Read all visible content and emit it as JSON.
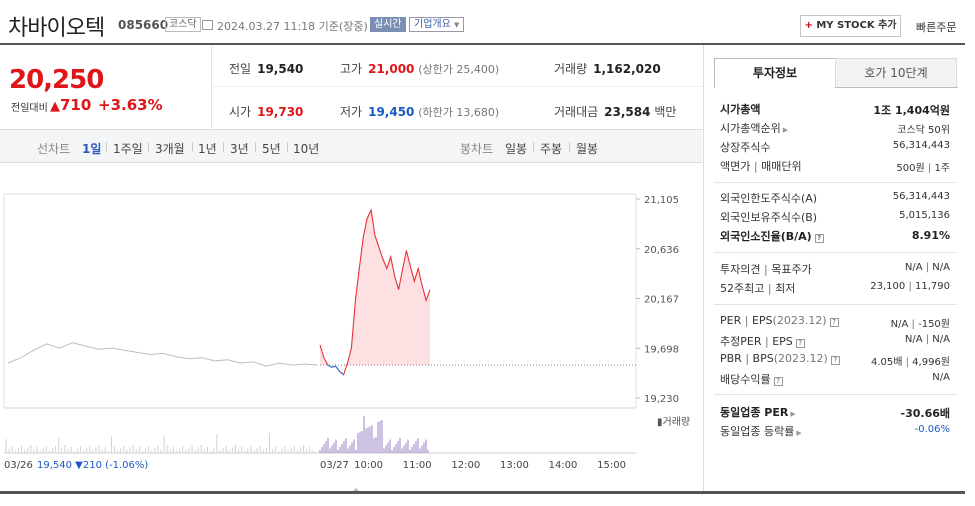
{
  "header": {
    "stock_name": "차바이오텍",
    "code": "085660",
    "market": "코스닥",
    "datetime": "2024.03.27 11:18 기준(장중)",
    "realtime_badge": "실시간",
    "overview_button": "기업개요",
    "mystock_plus": "+",
    "mystock_label": " MY STOCK 추가",
    "quick_order": "빠른주문"
  },
  "price": {
    "current": "20,250",
    "change_label": "전일대비",
    "change_arrow": "▲",
    "change": "710",
    "change_pct": "+3.63%"
  },
  "stats": {
    "prev_close_label": "전일",
    "prev_close": "19,540",
    "high_label": "고가",
    "high": "21,000",
    "upper_limit": "(상한가 25,400)",
    "volume_label": "거래량",
    "volume": "1,162,020",
    "open_label": "시가",
    "open": "19,730",
    "low_label": "저가",
    "low": "19,450",
    "lower_limit": "(하한가 13,680)",
    "amount_label": "거래대금",
    "amount": "23,584",
    "amount_unit": "백만"
  },
  "periods": {
    "line_label": "선차트",
    "items": [
      "1일",
      "1주일",
      "3개월",
      "1년",
      "3년",
      "5년",
      "10년"
    ],
    "selected_index": 0,
    "candle_label": "봉차트",
    "candle_items": [
      "일봉",
      "주봉",
      "월봉"
    ]
  },
  "chart_data": {
    "type": "line",
    "y_ticks": [
      "21,105",
      "20,636",
      "20,167",
      "19,698",
      "19,230"
    ],
    "ylim": [
      19230,
      21105
    ],
    "prev_close_ref": 19540,
    "x_ticks": [
      "03/26",
      "03/27",
      "10:00",
      "11:00",
      "12:00",
      "13:00",
      "14:00",
      "15:00"
    ],
    "prev_day_caption": {
      "date": "03/26",
      "close": "19,540",
      "change": "▼210",
      "pct": "(-1.06%)"
    },
    "volume_legend": "거래량",
    "series": [
      {
        "name": "",
        "values": [
          19560,
          19610,
          19680,
          19740,
          19700,
          19750,
          19720,
          19690,
          19700,
          19680,
          19660,
          19640,
          19650,
          19620,
          19600,
          19610,
          19580,
          19590,
          19560,
          19570,
          19530,
          19560,
          19540,
          19550,
          19540
        ]
      },
      {
        "name": "",
        "values": [
          19730,
          19610,
          19540,
          19520,
          19530,
          19480,
          19450,
          19560,
          19700,
          20150,
          20450,
          20740,
          20920,
          21000,
          20760,
          20650,
          20540,
          20450,
          20560,
          20380,
          20250,
          20440,
          20620,
          20470,
          20330,
          20450,
          20290,
          20150,
          20250
        ]
      }
    ]
  },
  "panel": {
    "tab_info": "투자정보",
    "tab_hoga": "호가 10단계",
    "market_cap_label": "시가총액",
    "market_cap": "1조 1,404억원",
    "market_rank_label": "시가총액순위",
    "market_rank": "코스닥 50위",
    "shares_label": "상장주식수",
    "shares": "56,314,443",
    "par_label": "액면가",
    "unit_label": "매매단위",
    "par": "500원",
    "unit": "1주",
    "foreign_limit_label": "외국인한도주식수(A)",
    "foreign_limit": "56,314,443",
    "foreign_hold_label": "외국인보유주식수(B)",
    "foreign_hold": "5,015,136",
    "foreign_ratio_label": "외국인소진율(B/A)",
    "foreign_ratio": "8.91%",
    "opinion_label": "투자의견",
    "target_label": "목표주가",
    "opinion": "N/A",
    "target": "N/A",
    "w52_high_label": "52주최고",
    "w52_low_label": "최저",
    "w52_high": "23,100",
    "w52_low": "11,790",
    "per_label": "PER",
    "eps_label": "EPS",
    "per_period": "(2023.12)",
    "per": "N/A",
    "eps": "-150원",
    "est_per_label": "추정PER",
    "est_eps_label": "EPS",
    "est_per": "N/A",
    "est_eps": "N/A",
    "pbr_label": "PBR",
    "bps_label": "BPS",
    "bps_period": "(2023.12)",
    "pbr": "4.05배",
    "bps": "4,996원",
    "div_label": "배당수익률",
    "div": "N/A",
    "ind_per_label": "동일업종 PER",
    "ind_per": "-30.66배",
    "ind_rate_label": "동일업종 등락률",
    "ind_rate": "-0.06%",
    "sep": "|"
  }
}
